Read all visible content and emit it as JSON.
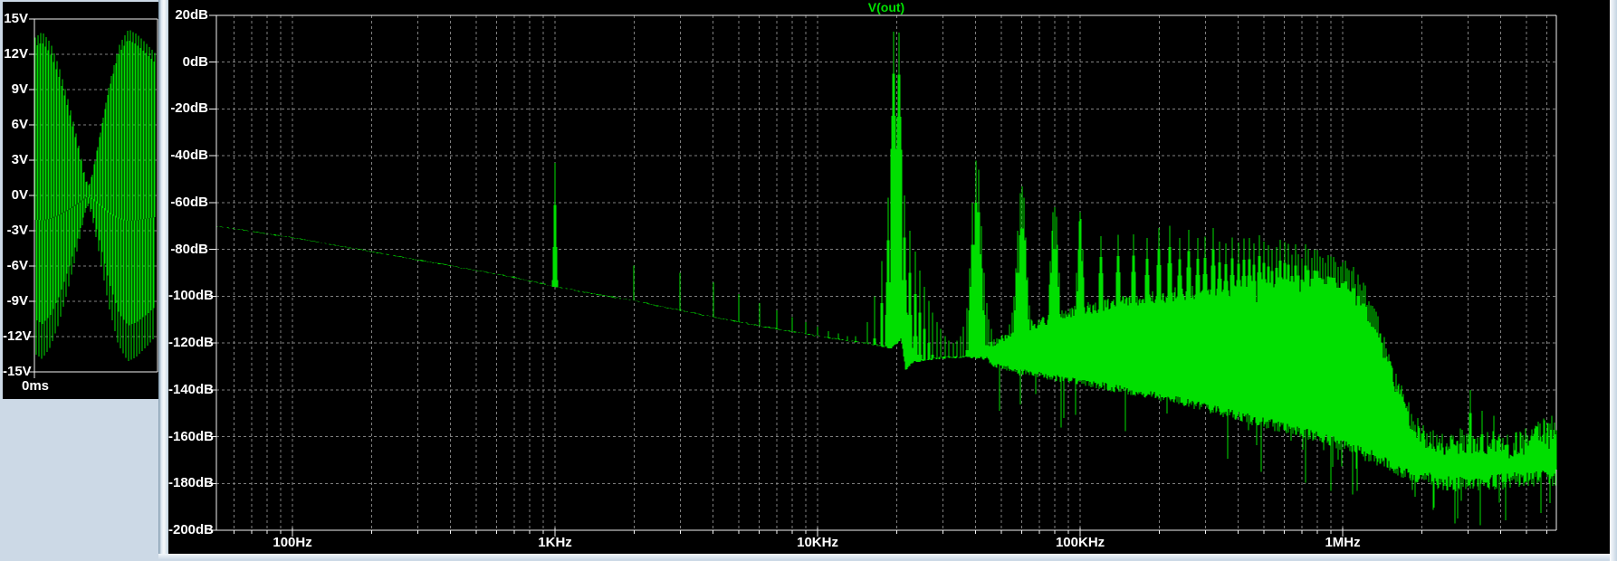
{
  "window": {
    "background": "#ccd9e6",
    "panel_background": "#000000",
    "grid_color": "#7f7f7f",
    "axis_color": "#f2f2f2",
    "label_color": "#ffffff",
    "trace_color": "#00df00",
    "title_color": "#00df00"
  },
  "left_panel": {
    "x_axis_label": "0ms",
    "y_tick_labels": [
      "15V",
      "12V",
      "9V",
      "6V",
      "3V",
      "0V",
      "-3V",
      "-6V",
      "-9V",
      "-12V",
      "-15V"
    ],
    "chart_data": {
      "type": "line",
      "ylabel": "V",
      "ylim": [
        -15,
        15
      ],
      "y_step": 3,
      "x_start_label": "0ms",
      "description": "time-domain amplitude-modulated sine burst, two envelope lobes",
      "carrier_cycles": 44,
      "carrier_phase": 1.2,
      "envelope_v": [
        [
          0,
          13.5
        ],
        [
          0.06,
          14
        ],
        [
          0.13,
          13
        ],
        [
          0.2,
          11
        ],
        [
          0.28,
          8
        ],
        [
          0.36,
          4.5
        ],
        [
          0.42,
          1.5
        ],
        [
          0.45,
          0.8
        ],
        [
          0.48,
          1.8
        ],
        [
          0.54,
          5
        ],
        [
          0.62,
          9.5
        ],
        [
          0.7,
          12.8
        ],
        [
          0.78,
          14.2
        ],
        [
          0.85,
          13.8
        ],
        [
          0.93,
          13
        ],
        [
          1,
          12.2
        ]
      ]
    }
  },
  "main_panel": {
    "title": "V(out)",
    "y_tick_labels": [
      "20dB",
      "0dB",
      "-20dB",
      "-40dB",
      "-60dB",
      "-80dB",
      "-100dB",
      "-120dB",
      "-140dB",
      "-160dB",
      "-180dB",
      "-200dB"
    ],
    "x_tick_labels": [
      {
        "label": "100Hz",
        "hz": 100
      },
      {
        "label": "1KHz",
        "hz": 1000
      },
      {
        "label": "10KHz",
        "hz": 10000
      },
      {
        "label": "100KHz",
        "hz": 100000
      },
      {
        "label": "1MHz",
        "hz": 1000000
      }
    ],
    "chart_data": {
      "type": "line",
      "title": "V(out)",
      "x_scale": "log",
      "xlim_hz": [
        51.3,
        6510000
      ],
      "ylim_db": [
        -200,
        20
      ],
      "y_step_db": 20,
      "noise_floor_db": [
        [
          51,
          -70
        ],
        [
          100,
          -75
        ],
        [
          200,
          -81
        ],
        [
          400,
          -87
        ],
        [
          700,
          -92
        ],
        [
          1000,
          -96
        ],
        [
          2000,
          -102
        ],
        [
          4000,
          -109
        ],
        [
          7000,
          -114
        ],
        [
          10000,
          -117
        ],
        [
          15000,
          -120
        ],
        [
          19000,
          -122
        ],
        [
          20000,
          -120
        ],
        [
          20800,
          -118
        ],
        [
          21600,
          -131
        ],
        [
          23000,
          -128
        ],
        [
          26000,
          -127
        ],
        [
          32000,
          -126
        ],
        [
          40000,
          -126
        ],
        [
          60000,
          -128
        ],
        [
          100000,
          -131
        ],
        [
          200000,
          -137
        ],
        [
          400000,
          -145
        ],
        [
          700000,
          -152
        ],
        [
          1000000,
          -157
        ],
        [
          1500000,
          -163
        ],
        [
          2000000,
          -167
        ],
        [
          3000000,
          -169
        ],
        [
          6500000,
          -169
        ]
      ],
      "peaks_db": [
        [
          1000,
          -43
        ],
        [
          2000,
          -87
        ],
        [
          3000,
          -90
        ],
        [
          4000,
          -94
        ],
        [
          5000,
          -99
        ],
        [
          6000,
          -103
        ],
        [
          7000,
          -106
        ],
        [
          8000,
          -109
        ],
        [
          9000,
          -111
        ],
        [
          10000,
          -113
        ],
        [
          11000,
          -115
        ],
        [
          12000,
          -116
        ],
        [
          13000,
          -117
        ],
        [
          14000,
          -117
        ],
        [
          15500,
          -111
        ],
        [
          16500,
          -100
        ],
        [
          17500,
          -85
        ],
        [
          18500,
          -58
        ],
        [
          19500,
          13
        ],
        [
          20500,
          12.6
        ],
        [
          21500,
          -57
        ],
        [
          22500,
          -72
        ],
        [
          23500,
          -81
        ],
        [
          24500,
          -89
        ],
        [
          25500,
          -96
        ],
        [
          26500,
          -102
        ],
        [
          27500,
          -107
        ],
        [
          28500,
          -111
        ],
        [
          29500,
          -114
        ],
        [
          30500,
          -117
        ],
        [
          31500,
          -119
        ],
        [
          33000,
          -120
        ],
        [
          34000,
          -119
        ],
        [
          35000,
          -117
        ],
        [
          36000,
          -113
        ],
        [
          37000,
          -105
        ],
        [
          38000,
          -88
        ],
        [
          39000,
          -60
        ],
        [
          40000,
          -42
        ],
        [
          41000,
          -46
        ],
        [
          42000,
          -70
        ],
        [
          43000,
          -90
        ],
        [
          44000,
          -103
        ],
        [
          45000,
          -110
        ],
        [
          46000,
          -114
        ],
        [
          54000,
          -112
        ],
        [
          55000,
          -107
        ],
        [
          56000,
          -100
        ],
        [
          57000,
          -88
        ],
        [
          58000,
          -72
        ],
        [
          59000,
          -56
        ],
        [
          60000,
          -53
        ],
        [
          61000,
          -58
        ],
        [
          62000,
          -75
        ],
        [
          63000,
          -92
        ],
        [
          64000,
          -104
        ],
        [
          65000,
          -110
        ],
        [
          76000,
          -95
        ],
        [
          77000,
          -85
        ],
        [
          78000,
          -72
        ],
        [
          79000,
          -64
        ],
        [
          80000,
          -62
        ],
        [
          81000,
          -66
        ],
        [
          82000,
          -78
        ],
        [
          83000,
          -90
        ],
        [
          97000,
          -90
        ],
        [
          98000,
          -80
        ],
        [
          99000,
          -68
        ],
        [
          100000,
          -64
        ],
        [
          101000,
          -67
        ],
        [
          102000,
          -80
        ],
        [
          103000,
          -92
        ]
      ],
      "harmonic_forest": {
        "fundamental_hz": 20000,
        "from_n": 6,
        "to_n": 92,
        "level_jitter_db": 3.5,
        "skirt_db": [
          9,
          16
        ],
        "envelope_db": [
          [
            120000,
            -73
          ],
          [
            150000,
            -70
          ],
          [
            180000,
            -73
          ],
          [
            220000,
            -71
          ],
          [
            260000,
            -74
          ],
          [
            320000,
            -73
          ],
          [
            380000,
            -75
          ],
          [
            450000,
            -76
          ],
          [
            520000,
            -78
          ],
          [
            600000,
            -79
          ],
          [
            700000,
            -81
          ],
          [
            800000,
            -82
          ],
          [
            900000,
            -84
          ],
          [
            1000000,
            -86
          ],
          [
            1100000,
            -91
          ],
          [
            1200000,
            -97
          ],
          [
            1300000,
            -105
          ],
          [
            1400000,
            -116
          ],
          [
            1500000,
            -128
          ],
          [
            1600000,
            -141
          ],
          [
            1700000,
            -151
          ],
          [
            1850000,
            -160
          ]
        ]
      },
      "mass_start_hz": 45000,
      "mass_top_db": [
        [
          45000,
          -121
        ],
        [
          60000,
          -114
        ],
        [
          80000,
          -109
        ],
        [
          100000,
          -106
        ],
        [
          150000,
          -102
        ],
        [
          250000,
          -99
        ],
        [
          400000,
          -98
        ],
        [
          600000,
          -100
        ],
        [
          800000,
          -103
        ],
        [
          1000000,
          -107
        ],
        [
          1150000,
          -111
        ],
        [
          1300000,
          -117
        ],
        [
          1450000,
          -127
        ],
        [
          1600000,
          -138
        ],
        [
          1750000,
          -148
        ],
        [
          1900000,
          -156
        ],
        [
          2100000,
          -162
        ],
        [
          2400000,
          -164
        ],
        [
          2800000,
          -162
        ],
        [
          3200000,
          -164
        ],
        [
          3700000,
          -163
        ],
        [
          4200000,
          -164
        ],
        [
          4800000,
          -163
        ],
        [
          5300000,
          -161
        ],
        [
          5800000,
          -158
        ],
        [
          6100000,
          -160
        ],
        [
          6500000,
          -159
        ]
      ],
      "mass_bottom_db": [
        [
          45000,
          -128
        ],
        [
          60000,
          -131
        ],
        [
          100000,
          -135
        ],
        [
          200000,
          -141
        ],
        [
          400000,
          -149
        ],
        [
          700000,
          -156
        ],
        [
          1000000,
          -161
        ],
        [
          1300000,
          -166
        ],
        [
          1600000,
          -171
        ],
        [
          2000000,
          -175
        ],
        [
          2600000,
          -177
        ],
        [
          3500000,
          -176
        ],
        [
          5000000,
          -175
        ],
        [
          6500000,
          -174
        ]
      ],
      "up_spikes_db": [
        [
          3050000,
          -140
        ],
        [
          3400000,
          -149
        ],
        [
          3750000,
          -151
        ],
        [
          4600000,
          -158
        ],
        [
          6250000,
          -151
        ],
        [
          6400000,
          -154
        ]
      ],
      "noise_amp_db": [
        [
          51,
          0.4
        ],
        [
          15000,
          0.6
        ],
        [
          40000,
          1.5
        ],
        [
          80000,
          2.5
        ],
        [
          300000,
          3.5
        ],
        [
          1200000,
          4.5
        ],
        [
          2000000,
          5.5
        ],
        [
          6500000,
          6
        ]
      ],
      "down_spike": {
        "prob": 0.05,
        "max_extra_db": 22
      }
    }
  }
}
